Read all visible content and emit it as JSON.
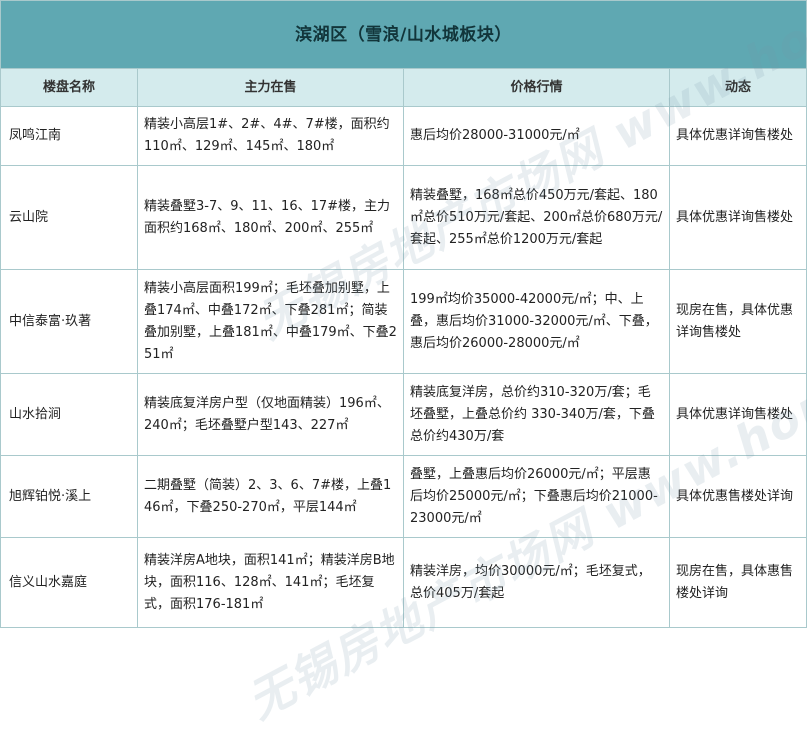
{
  "table": {
    "title": "滨湖区（雪浪/山水城板块）",
    "headers": {
      "name": "楼盘名称",
      "main_sale": "主力在售",
      "price": "价格行情",
      "status": "动态"
    },
    "rows": [
      {
        "name": "凤鸣江南",
        "main_sale": "精装小高层1#、2#、4#、7#楼，面积约110㎡、129㎡、145㎡、180㎡",
        "price": "惠后均价28000-31000元/㎡",
        "status": "具体优惠详询售楼处"
      },
      {
        "name": "云山院",
        "main_sale": "精装叠墅3-7、9、11、16、17#楼，主力面积约168㎡、180㎡、200㎡、255㎡",
        "price": "精装叠墅，168㎡总价450万元/套起、180㎡总价510万元/套起、200㎡总价680万元/套起、255㎡总价1200万元/套起",
        "status": "具体优惠详询售楼处"
      },
      {
        "name": "中信泰富·玖著",
        "main_sale": "精装小高层面积199㎡；毛坯叠加别墅，上叠174㎡、中叠172㎡、下叠281㎡；简装叠加别墅，上叠181㎡、中叠179㎡、下叠251㎡",
        "price": "199㎡均价35000-42000元/㎡；中、上叠，惠后均价31000-32000元/㎡、下叠，惠后均价26000-28000元/㎡",
        "status": "现房在售，具体优惠详询售楼处"
      },
      {
        "name": "山水拾涧",
        "main_sale": "精装底复洋房户型（仅地面精装）196㎡、240㎡；毛坯叠墅户型143、227㎡",
        "price": "精装底复洋房，总价约310-320万/套；毛坯叠墅，上叠总价约 330-340万/套，下叠总价约430万/套",
        "status": "具体优惠详询售楼处"
      },
      {
        "name": "旭辉铂悦·溪上",
        "main_sale": "二期叠墅（简装）2、3、6、7#楼，上叠146㎡，下叠250-270㎡，平层144㎡",
        "price": "叠墅，上叠惠后均价26000元/㎡；平层惠后均价25000元/㎡；下叠惠后均价21000-23000元/㎡",
        "status": "具体优惠售楼处详询"
      },
      {
        "name": "信义山水嘉庭",
        "main_sale": "精装洋房A地块，面积141㎡；精装洋房B地块，面积116、128㎡、141㎡；毛坯复式，面积176-181㎡",
        "price": "精装洋房，均价30000元/㎡；毛坯复式，总价405万/套起",
        "status": "现房在售，具体惠售楼处详询"
      }
    ]
  },
  "colors": {
    "title_bg": "#5fa8b2",
    "header_bg": "#d4ebed",
    "border": "#a9c9cc"
  }
}
